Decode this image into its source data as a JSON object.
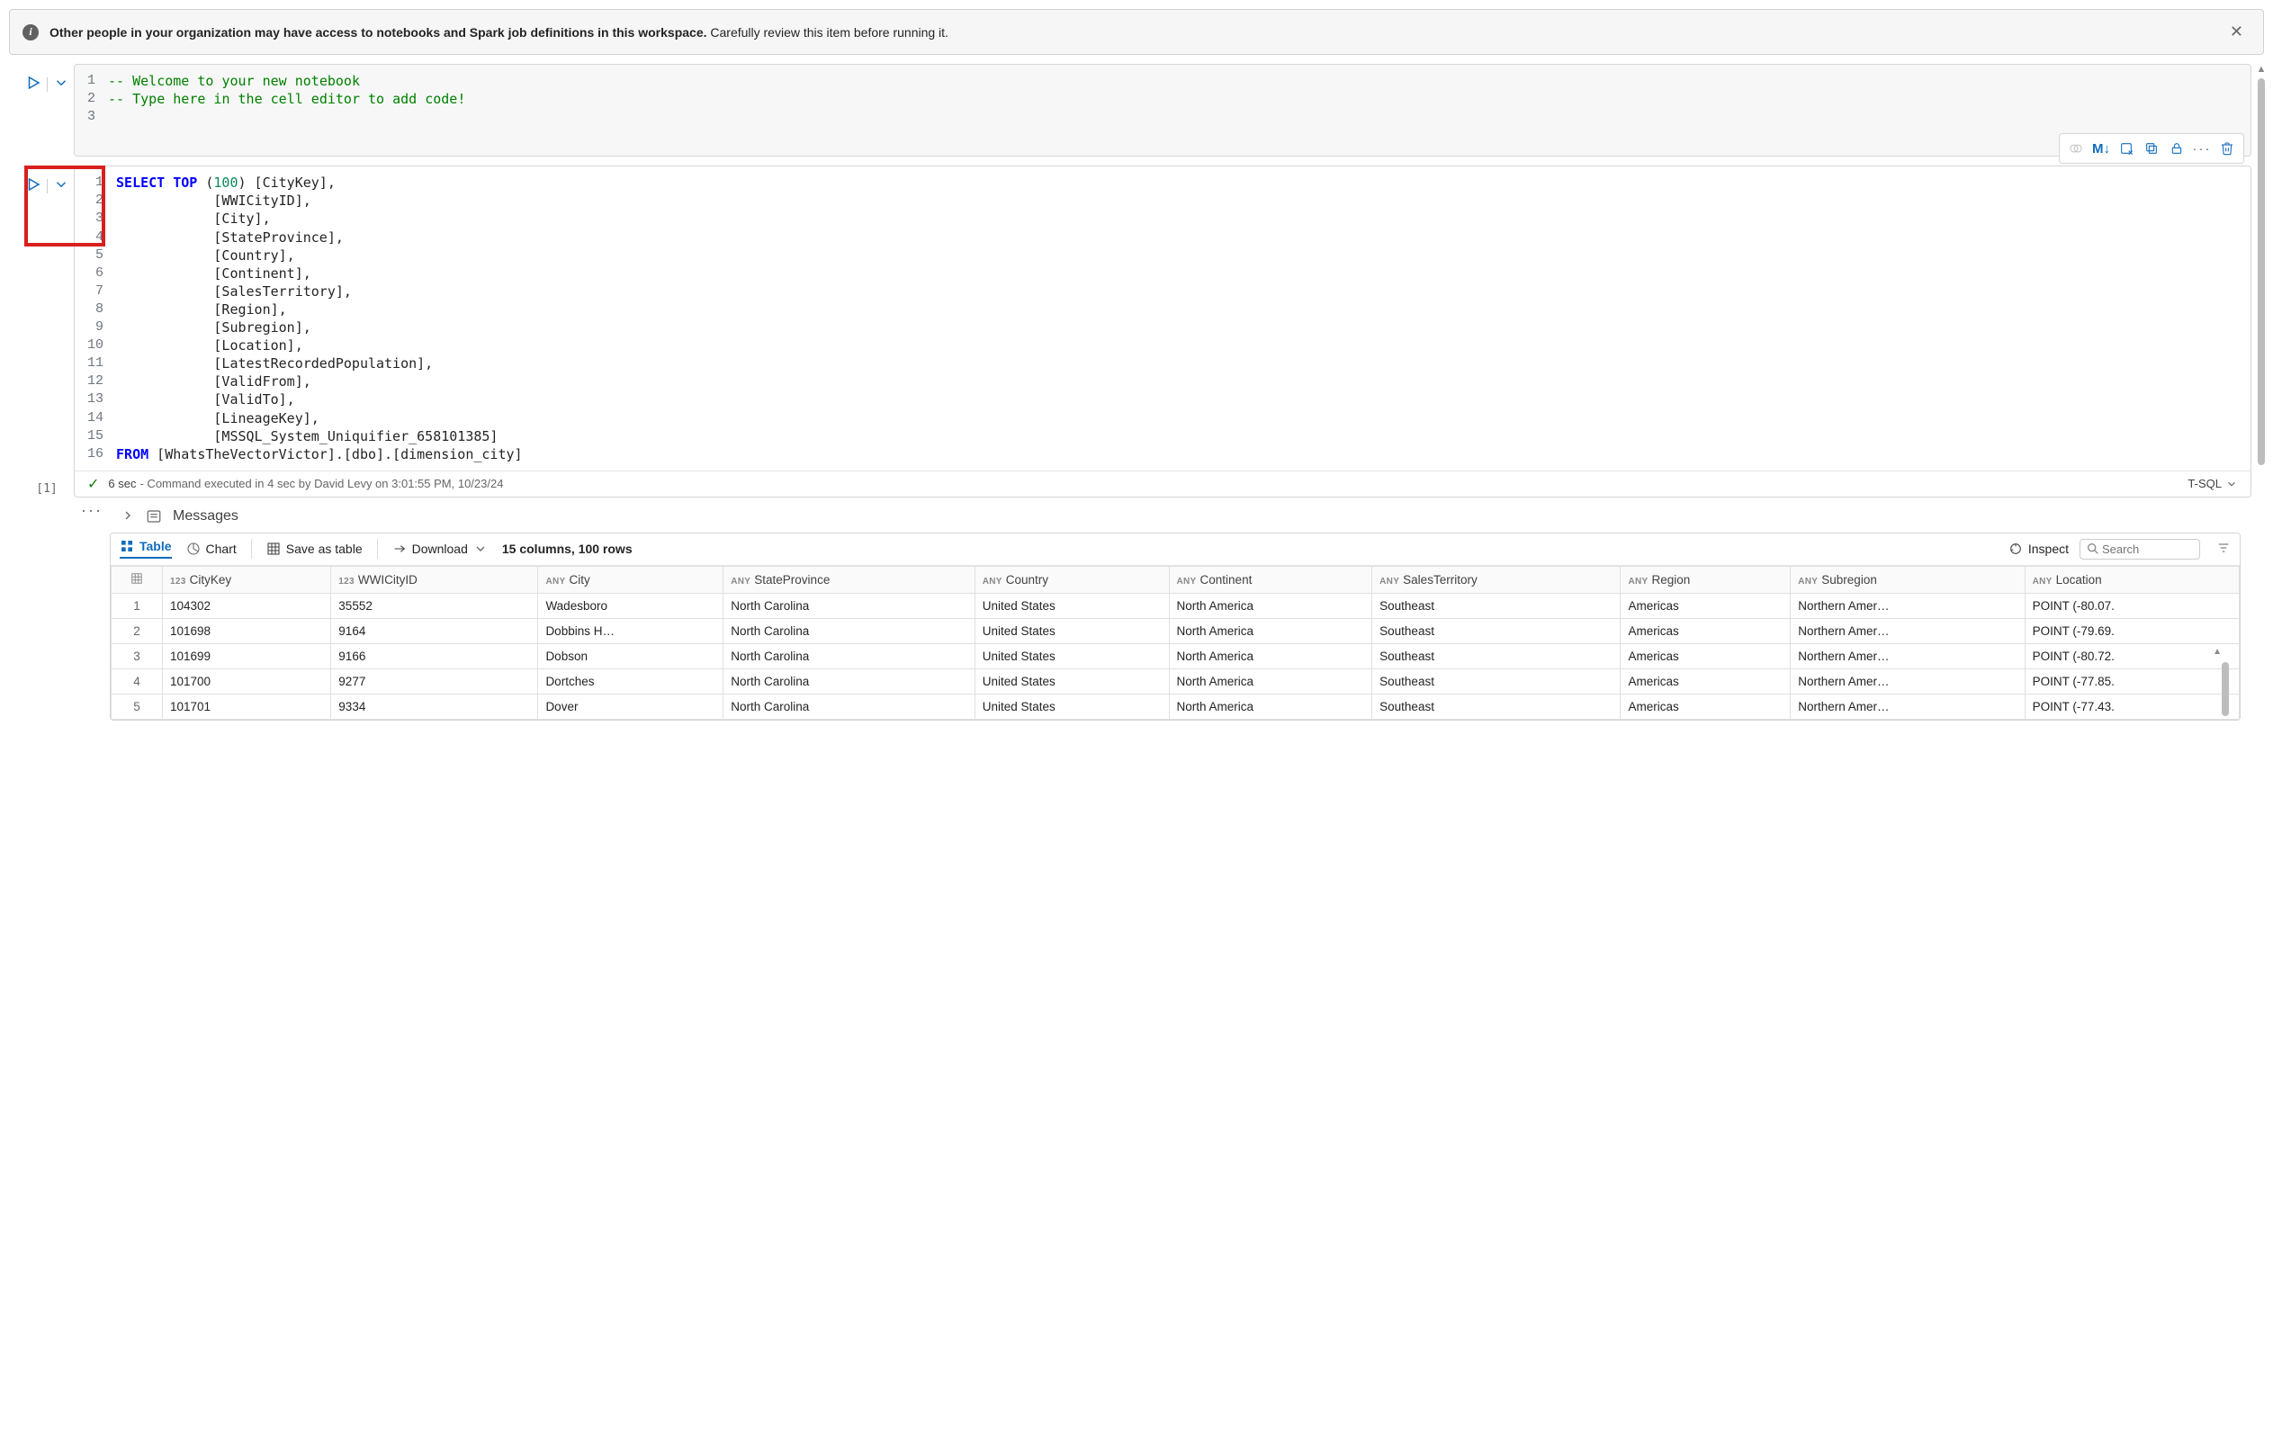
{
  "infobar": {
    "bold": "Other people in your organization may have access to notebooks and Spark job definitions in this workspace.",
    "rest": " Carefully review this item before running it."
  },
  "cell1": {
    "lang": "T-SQL",
    "linecount": 3,
    "lines_html": "<span class='c'>-- Welcome to your new notebook</span>\n<span class='c'>-- Type here in the cell editor to add code!</span>\n"
  },
  "cell2": {
    "index_label": "[1]",
    "lang": "T-SQL",
    "status_time": "6 sec",
    "status_detail": "- Command executed in 4 sec by David Levy on 3:01:55 PM, 10/23/24",
    "toolbar": {
      "markdown": "M↓"
    },
    "linecount": 16,
    "lines_html": "<span class='kw'>SELECT</span> <span class='kw'>TOP</span> (<span class='num'>100</span>) [CityKey],\n            [WWICityID],\n            [City],\n            [StateProvince],\n            [Country],\n            [Continent],\n            [SalesTerritory],\n            [Region],\n            [Subregion],\n            [Location],\n            [LatestRecordedPopulation],\n            [ValidFrom],\n            [ValidTo],\n            [LineageKey],\n            [MSSQL_System_Uniquifier_658101385]\n<span class='kw'>FROM</span> [WhatsTheVectorVictor].[dbo].[dimension_city]"
  },
  "results": {
    "messages_label": "Messages",
    "tabs": {
      "table": "Table",
      "chart": "Chart"
    },
    "save_as_table": "Save as table",
    "download": "Download",
    "meta": "15 columns, 100 rows",
    "inspect": "Inspect",
    "search_placeholder": "Search",
    "columns": [
      {
        "type": "123",
        "name": "CityKey"
      },
      {
        "type": "123",
        "name": "WWICityID"
      },
      {
        "type": "ANY",
        "name": "City"
      },
      {
        "type": "ANY",
        "name": "StateProvince"
      },
      {
        "type": "ANY",
        "name": "Country"
      },
      {
        "type": "ANY",
        "name": "Continent"
      },
      {
        "type": "ANY",
        "name": "SalesTerritory"
      },
      {
        "type": "ANY",
        "name": "Region"
      },
      {
        "type": "ANY",
        "name": "Subregion"
      },
      {
        "type": "ANY",
        "name": "Location"
      }
    ],
    "rows": [
      {
        "idx": "1",
        "CityKey": "104302",
        "WWICityID": "35552",
        "City": "Wadesboro",
        "StateProvince": "North Carolina",
        "Country": "United States",
        "Continent": "North America",
        "SalesTerritory": "Southeast",
        "Region": "Americas",
        "Subregion": "Northern Amer…",
        "Location": "POINT (-80.07."
      },
      {
        "idx": "2",
        "CityKey": "101698",
        "WWICityID": "9164",
        "City": "Dobbins H…",
        "StateProvince": "North Carolina",
        "Country": "United States",
        "Continent": "North America",
        "SalesTerritory": "Southeast",
        "Region": "Americas",
        "Subregion": "Northern Amer…",
        "Location": "POINT (-79.69."
      },
      {
        "idx": "3",
        "CityKey": "101699",
        "WWICityID": "9166",
        "City": "Dobson",
        "StateProvince": "North Carolina",
        "Country": "United States",
        "Continent": "North America",
        "SalesTerritory": "Southeast",
        "Region": "Americas",
        "Subregion": "Northern Amer…",
        "Location": "POINT (-80.72."
      },
      {
        "idx": "4",
        "CityKey": "101700",
        "WWICityID": "9277",
        "City": "Dortches",
        "StateProvince": "North Carolina",
        "Country": "United States",
        "Continent": "North America",
        "SalesTerritory": "Southeast",
        "Region": "Americas",
        "Subregion": "Northern Amer…",
        "Location": "POINT (-77.85."
      },
      {
        "idx": "5",
        "CityKey": "101701",
        "WWICityID": "9334",
        "City": "Dover",
        "StateProvince": "North Carolina",
        "Country": "United States",
        "Continent": "North America",
        "SalesTerritory": "Southeast",
        "Region": "Americas",
        "Subregion": "Northern Amer…",
        "Location": "POINT (-77.43."
      }
    ]
  }
}
